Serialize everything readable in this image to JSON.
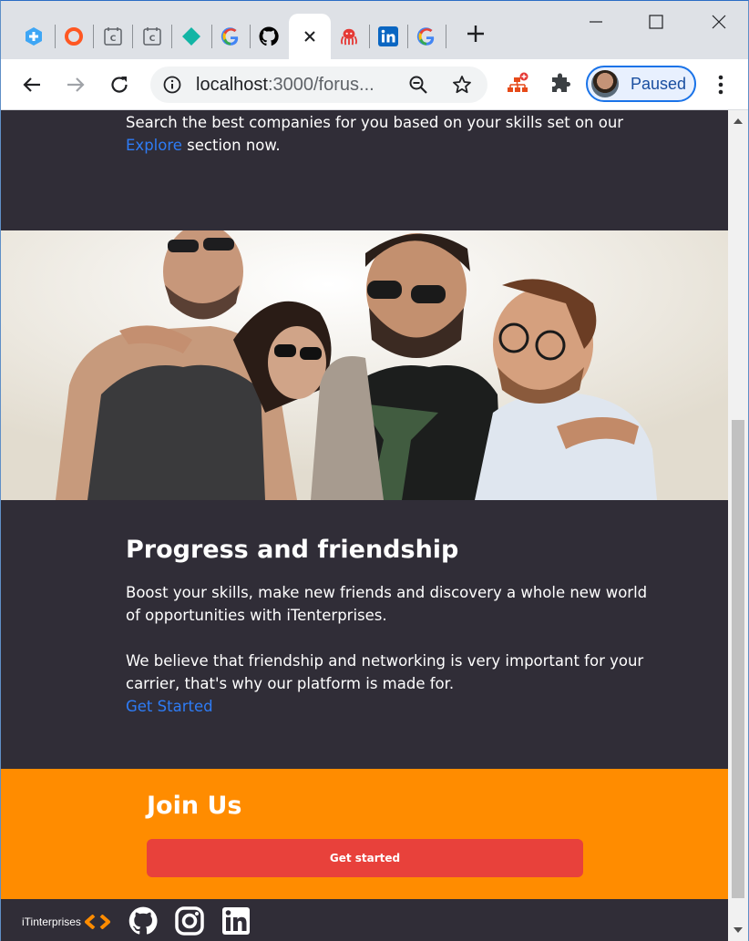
{
  "browser": {
    "tabs": [
      {
        "icon": "plus-shield-icon",
        "color": "#1a73e8"
      },
      {
        "icon": "orange-ring-icon",
        "color": "#ff5722"
      },
      {
        "icon": "calendar-c-icon",
        "color": "#5f6368"
      },
      {
        "icon": "calendar-c-icon",
        "color": "#5f6368"
      },
      {
        "icon": "teal-diamond-icon",
        "color": "#12b5a5"
      },
      {
        "icon": "google-g-icon",
        "color": "#4285f4"
      },
      {
        "icon": "github-icon",
        "color": "#000000"
      },
      {
        "icon": "close-icon",
        "color": "#202124",
        "active": true
      },
      {
        "icon": "octopus-icon",
        "color": "#e53935"
      },
      {
        "icon": "linkedin-icon",
        "color": "#0a66c2"
      },
      {
        "icon": "google-g-icon",
        "color": "#4285f4"
      }
    ],
    "url_host": "localhost",
    "url_rest": ":3000/forus...",
    "profile_label": "Paused"
  },
  "page": {
    "explore_line1": "Search the best companies for you based on your skills set on our",
    "explore_link": "Explore",
    "explore_line2": " section now.",
    "friendship": {
      "title": "Progress and friendship",
      "para1_line1": "Boost your skills, make new friends and discovery a whole new world",
      "para1_line2": "of opportunities with iTenterprises.",
      "para2_line1": "We believe that friendship and networking is very important for your",
      "para2_line2": "carrier, that's why our platform is made for.",
      "cta_link": "Get Started"
    },
    "join": {
      "title": "Join Us",
      "button": "Get started"
    },
    "footer": {
      "brand": "iTinterprises",
      "social": [
        "github-icon",
        "instagram-icon",
        "linkedin-icon"
      ]
    }
  },
  "colors": {
    "page_bg": "#302d37",
    "accent_orange": "#ff8c00",
    "button_red": "#e8413b",
    "link_blue": "#2e7cf6"
  }
}
